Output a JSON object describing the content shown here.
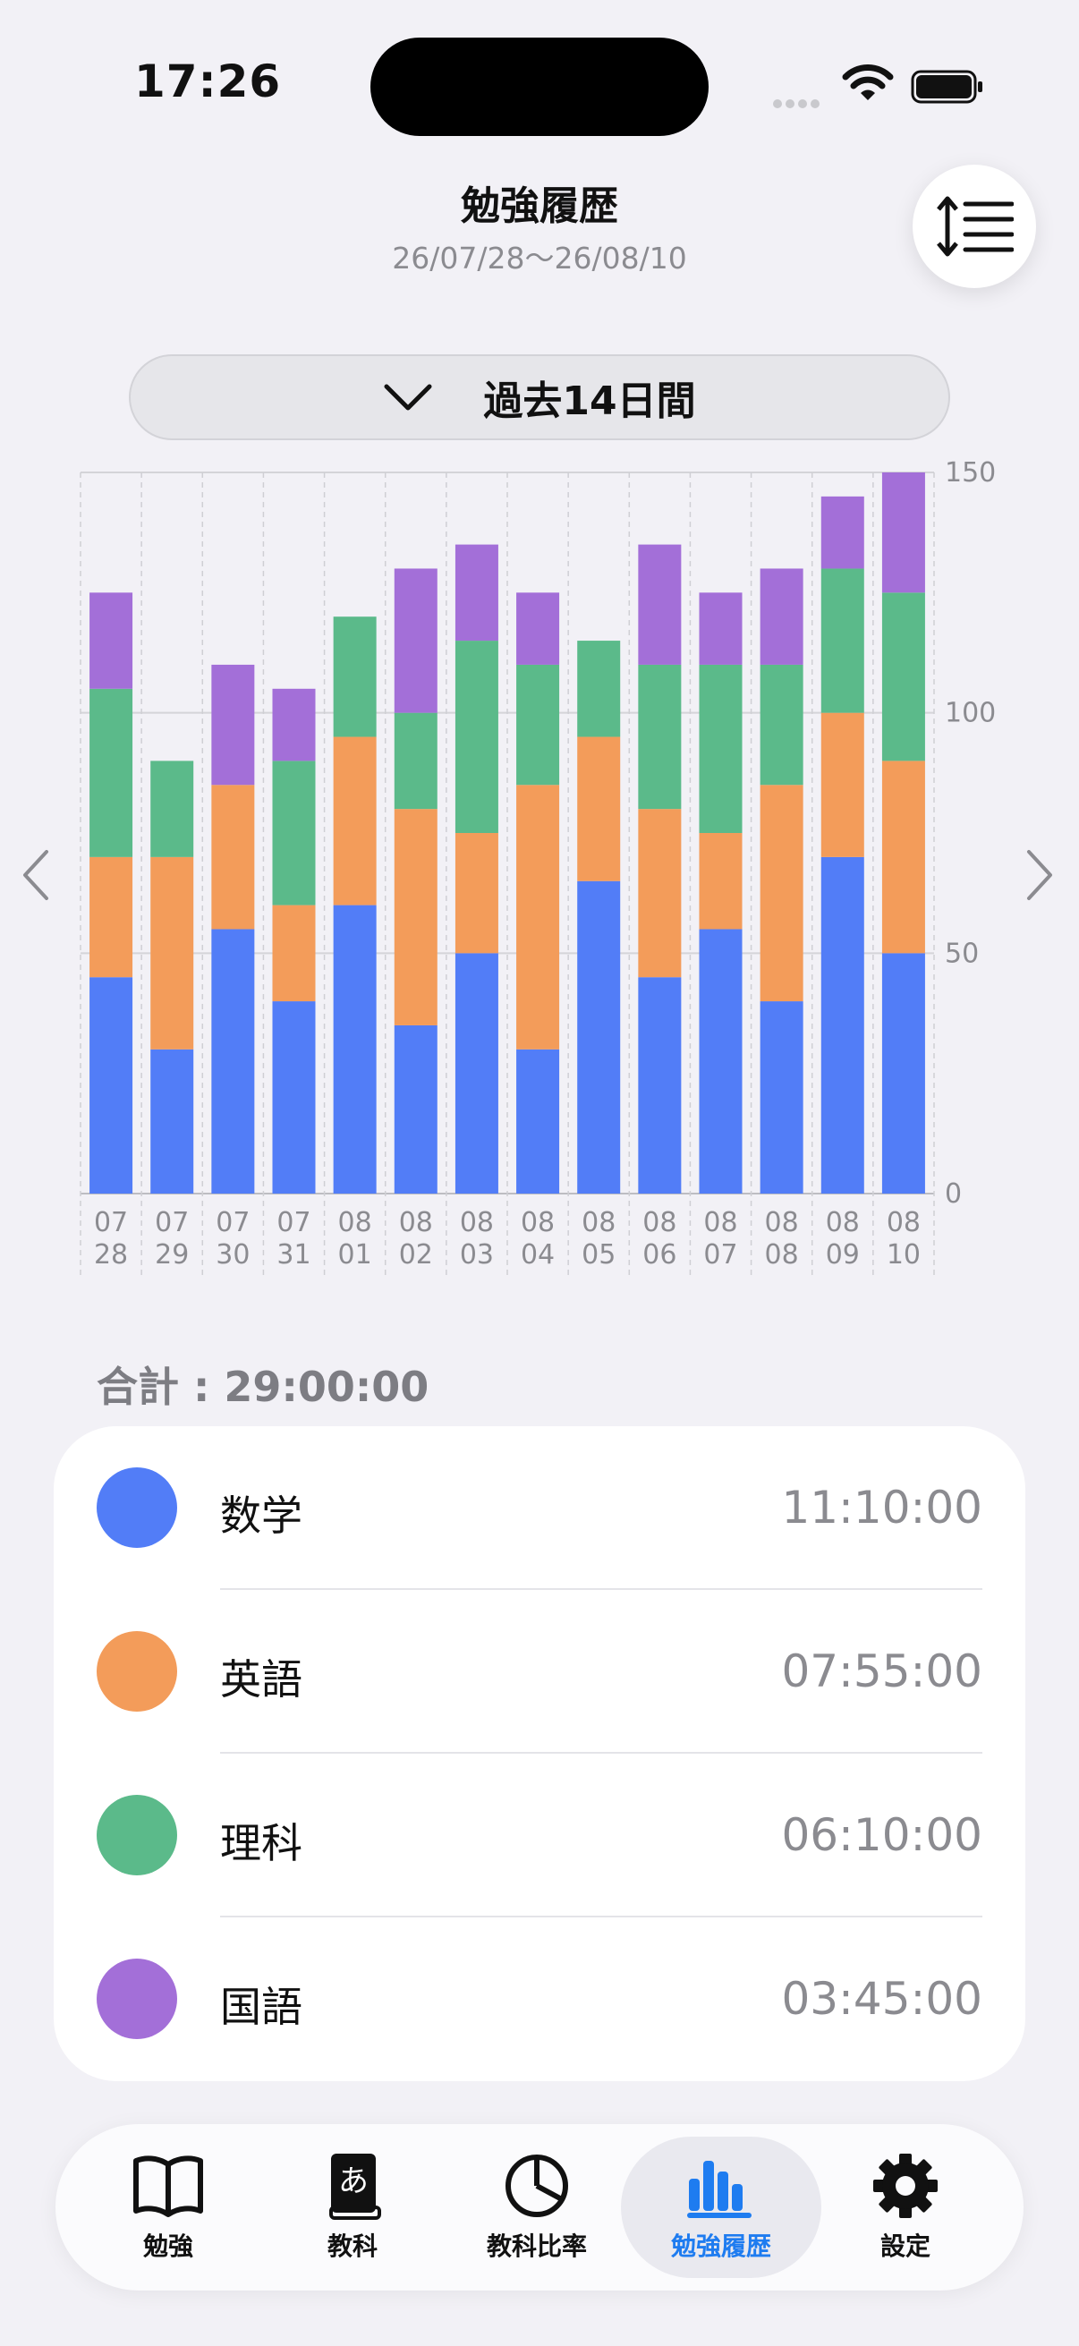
{
  "status_bar": {
    "time": "17:26"
  },
  "header": {
    "title": "勉強履歴",
    "date_range": "26/07/28～26/08/10"
  },
  "period_selector": {
    "label": "過去14日間"
  },
  "summary": {
    "total_label": "合計 : 29:00:00"
  },
  "chart_data": {
    "type": "bar",
    "stacked": true,
    "categories": [
      "07\n28",
      "07\n29",
      "07\n30",
      "07\n31",
      "08\n01",
      "08\n02",
      "08\n03",
      "08\n04",
      "08\n05",
      "08\n06",
      "08\n07",
      "08\n08",
      "08\n09",
      "08\n10"
    ],
    "category_lines": [
      [
        "07",
        "28"
      ],
      [
        "07",
        "29"
      ],
      [
        "07",
        "30"
      ],
      [
        "07",
        "31"
      ],
      [
        "08",
        "01"
      ],
      [
        "08",
        "02"
      ],
      [
        "08",
        "03"
      ],
      [
        "08",
        "04"
      ],
      [
        "08",
        "05"
      ],
      [
        "08",
        "06"
      ],
      [
        "08",
        "07"
      ],
      [
        "08",
        "08"
      ],
      [
        "08",
        "09"
      ],
      [
        "08",
        "10"
      ]
    ],
    "series": [
      {
        "name": "数学",
        "color": "#527df7",
        "values": [
          45,
          30,
          55,
          40,
          60,
          35,
          50,
          30,
          65,
          45,
          55,
          40,
          70,
          50
        ]
      },
      {
        "name": "英語",
        "color": "#f39c5a",
        "values": [
          25,
          40,
          30,
          20,
          35,
          45,
          25,
          55,
          30,
          35,
          20,
          45,
          30,
          40
        ]
      },
      {
        "name": "理科",
        "color": "#5bba8a",
        "values": [
          35,
          20,
          0,
          30,
          25,
          20,
          40,
          25,
          20,
          30,
          35,
          25,
          30,
          35
        ]
      },
      {
        "name": "国語",
        "color": "#a36fd8",
        "values": [
          20,
          0,
          25,
          15,
          0,
          30,
          20,
          15,
          0,
          25,
          15,
          20,
          15,
          25
        ]
      }
    ],
    "yticks": [
      0,
      50,
      100,
      150
    ],
    "ylim": [
      0,
      150
    ],
    "y_axis_position": "right",
    "grid": true
  },
  "legend": [
    {
      "name": "数学",
      "time": "11:10:00",
      "color": "#527df7"
    },
    {
      "name": "英語",
      "time": "07:55:00",
      "color": "#f39c5a"
    },
    {
      "name": "理科",
      "time": "06:10:00",
      "color": "#5bba8a"
    },
    {
      "name": "国語",
      "time": "03:45:00",
      "color": "#a36fd8"
    }
  ],
  "tabs": [
    {
      "label": "勉強",
      "icon": "book-icon"
    },
    {
      "label": "教科",
      "icon": "dictionary-icon"
    },
    {
      "label": "教科比率",
      "icon": "pie-chart-icon"
    },
    {
      "label": "勉強履歴",
      "icon": "bar-chart-icon",
      "active": true
    },
    {
      "label": "設定",
      "icon": "gear-icon"
    }
  ],
  "colors": {
    "accent": "#1e7cf0",
    "background": "#f2f1f6"
  }
}
